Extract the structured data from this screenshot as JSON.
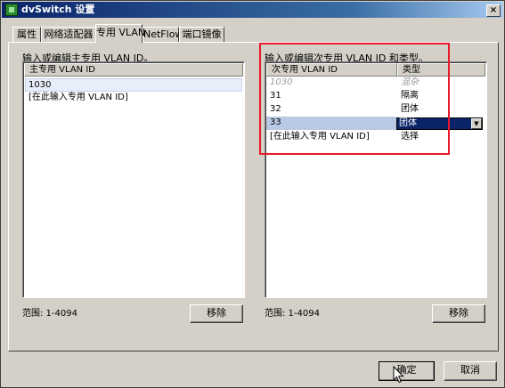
{
  "window": {
    "title": "dvSwitch 设置",
    "close_glyph": "×"
  },
  "tabs": [
    {
      "label": "属性"
    },
    {
      "label": "网络适配器"
    },
    {
      "label": "专用 VLAN"
    },
    {
      "label": "NetFlow"
    },
    {
      "label": "端口镜像"
    }
  ],
  "active_tab": "专用 VLAN",
  "primary": {
    "group_label": "输入或编辑主专用 VLAN ID。",
    "column": "主专用 VLAN ID",
    "rows": [
      "1030",
      "[在此输入专用 VLAN ID]"
    ],
    "range_label": "范围: 1-4094",
    "remove_button": "移除"
  },
  "secondary": {
    "group_label": "输入或编辑次专用 VLAN ID 和类型。",
    "columns": [
      "次专用 VLAN ID",
      "类型"
    ],
    "rows": [
      {
        "id": "1030",
        "type": "混杂"
      },
      {
        "id": "31",
        "type": "隔离"
      },
      {
        "id": "32",
        "type": "团体"
      },
      {
        "id": "33",
        "type": "团体"
      },
      {
        "id": "[在此输入专用 VLAN ID]",
        "type": "选择"
      }
    ],
    "range_label": "范围: 1-4094",
    "remove_button": "移除",
    "dropdown_arrow": "▼"
  },
  "footer": {
    "ok_button": "确定",
    "cancel_button": "取消"
  },
  "colors": {
    "highlight_box": "#e8192c",
    "title_bar": "#0a246a"
  }
}
